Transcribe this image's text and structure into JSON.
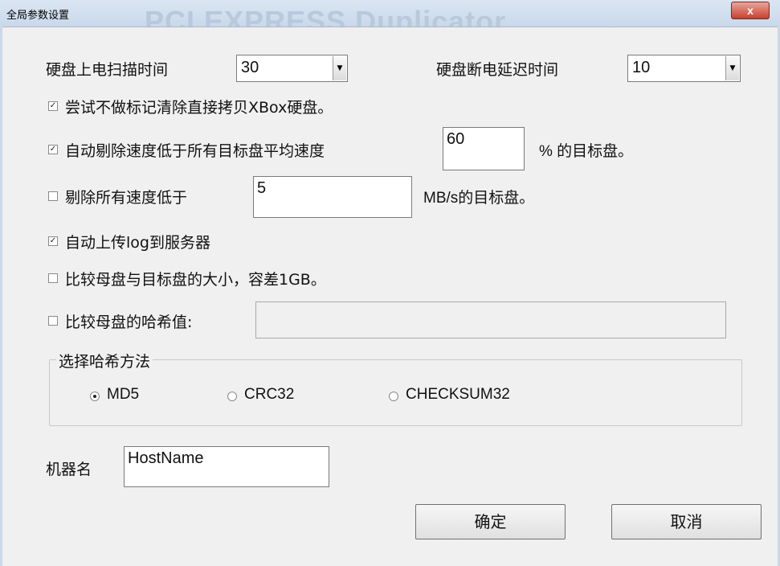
{
  "window": {
    "title": "全局参数设置",
    "background_title": "PCI EXPRESS Duplicator",
    "close_label": "x"
  },
  "power_scan": {
    "label": "硬盘上电扫描时间",
    "value": "30"
  },
  "power_off_delay": {
    "label": "硬盘断电延迟时间",
    "value": "10"
  },
  "xbox_copy": {
    "label": "尝试不做标记清除直接拷贝XBox硬盘。",
    "checked": true
  },
  "auto_remove_avg": {
    "label": "自动剔除速度低于所有目标盘平均速度",
    "value": "60",
    "suffix": "% 的目标盘。",
    "checked": true
  },
  "remove_below": {
    "label": "剔除所有速度低于",
    "value": "5",
    "suffix": "MB/s的目标盘。",
    "checked": false
  },
  "upload_log": {
    "label": "自动上传log到服务器",
    "checked": true
  },
  "compare_size": {
    "label": "比较母盘与目标盘的大小，容差1GB。",
    "checked": false
  },
  "compare_hash": {
    "label": "比较母盘的哈希值:",
    "value": "",
    "checked": false
  },
  "hash_method": {
    "legend": "选择哈希方法",
    "options": [
      "MD5",
      "CRC32",
      "CHECKSUM32"
    ],
    "selected": "MD5"
  },
  "machine_name": {
    "label": "机器名",
    "value": "HostName"
  },
  "buttons": {
    "ok": "确定",
    "cancel": "取消"
  }
}
